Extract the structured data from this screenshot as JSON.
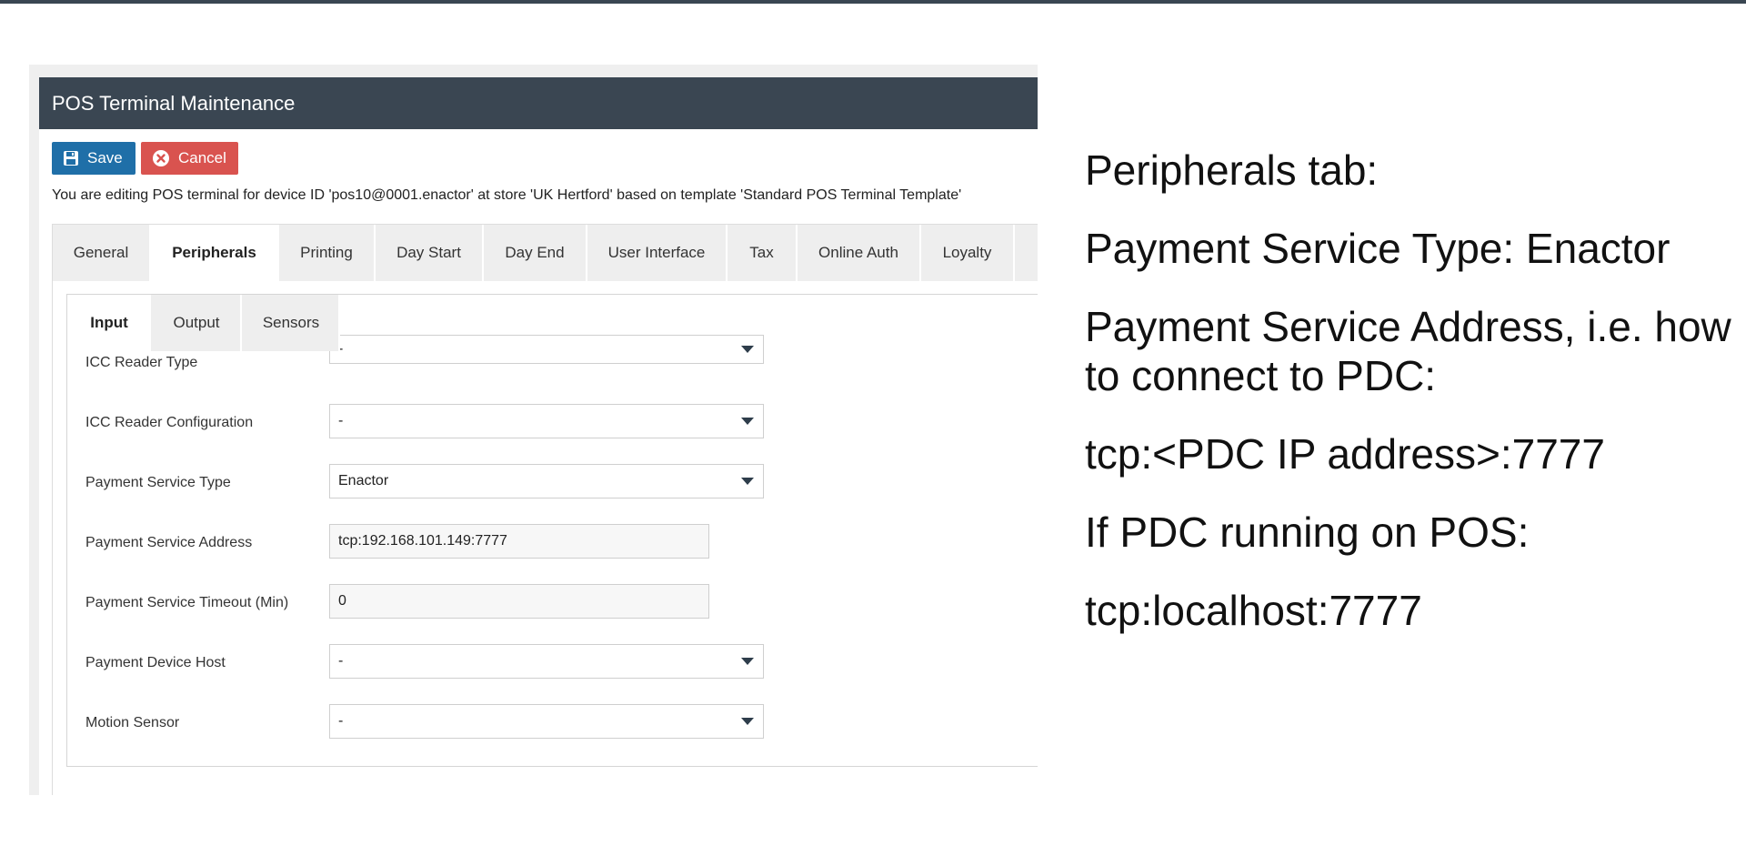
{
  "window": {
    "title": "POS Terminal Maintenance"
  },
  "toolbar": {
    "save_label": "Save",
    "cancel_label": "Cancel"
  },
  "info_text": "You are editing POS terminal for device ID 'pos10@0001.enactor' at store 'UK Hertford' based on template 'Standard POS Terminal Template'",
  "tabs": [
    {
      "label": "General"
    },
    {
      "label": "Peripherals"
    },
    {
      "label": "Printing"
    },
    {
      "label": "Day Start"
    },
    {
      "label": "Day End"
    },
    {
      "label": "User Interface"
    },
    {
      "label": "Tax"
    },
    {
      "label": "Online Auth"
    },
    {
      "label": "Loyalty"
    }
  ],
  "subtabs": [
    {
      "label": "Input"
    },
    {
      "label": "Output"
    },
    {
      "label": "Sensors"
    }
  ],
  "fields": [
    {
      "label": "ICC Reader Type",
      "value": "-"
    },
    {
      "label": "ICC Reader Configuration",
      "value": "-"
    },
    {
      "label": "Payment Service Type",
      "value": "Enactor"
    },
    {
      "label": "Payment Service Address",
      "value": "tcp:192.168.101.149:7777"
    },
    {
      "label": "Payment Service Timeout (Min)",
      "value": "0"
    },
    {
      "label": "Payment Device Host",
      "value": "-"
    },
    {
      "label": "Motion Sensor",
      "value": "-"
    }
  ],
  "notes": [
    "Peripherals tab:",
    "Payment Service Type: Enactor",
    "Payment Service Address, i.e. how to connect to PDC:",
    "tcp:<PDC IP address>:7777",
    "If PDC running on POS:",
    "tcp:localhost:7777"
  ],
  "colors": {
    "header": "#3a4652",
    "save": "#1f6fa8",
    "cancel": "#d9534f"
  }
}
